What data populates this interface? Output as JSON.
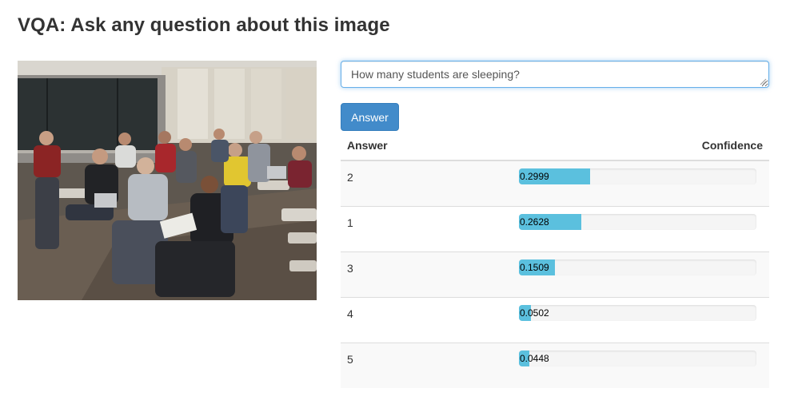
{
  "header": {
    "title": "VQA: Ask any question about this image"
  },
  "question": {
    "value": "How many students are sleeping?"
  },
  "answer_button": {
    "label": "Answer"
  },
  "results": {
    "columns": [
      "Answer",
      "Confidence"
    ],
    "rows": [
      {
        "answer": "2",
        "confidence": "0.2999",
        "fraction": 0.2999
      },
      {
        "answer": "1",
        "confidence": "0.2628",
        "fraction": 0.2628
      },
      {
        "answer": "3",
        "confidence": "0.1509",
        "fraction": 0.1509
      },
      {
        "answer": "4",
        "confidence": "0.0502",
        "fraction": 0.0502
      },
      {
        "answer": "5",
        "confidence": "0.0448",
        "fraction": 0.0448
      }
    ]
  },
  "colors": {
    "primary_button": "#428bca",
    "progress_fill": "#5bc0de",
    "input_focus_border": "#66afe9",
    "striped_row": "#f9f9f9"
  }
}
